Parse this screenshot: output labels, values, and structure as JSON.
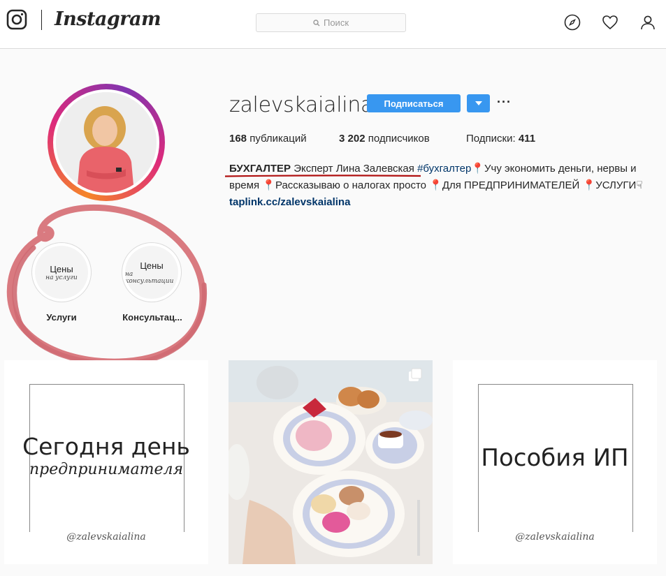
{
  "app": {
    "name": "Instagram"
  },
  "search": {
    "placeholder": "Поиск"
  },
  "profile": {
    "username": "zalevskaialina",
    "follow_label": "Подписаться",
    "more_label": "···",
    "stats": {
      "posts_count": "168",
      "posts_label": "публикаций",
      "followers_count": "3 202",
      "followers_label": "подписчиков",
      "following_label": "Подписки:",
      "following_count": "411"
    },
    "bio": {
      "title_bold": "БУХГАЛТЕР",
      "title_rest": "Эксперт Лина Залевская",
      "hashtag": "#бухгалтер",
      "part1": "Учу экономить деньги, нервы и время",
      "part2": "Рассказываю о налогах просто",
      "part3": "Для ПРЕДПРИНИМАТЕЛЕЙ",
      "part4": "УСЛУГИ",
      "link": "taplink.cc/zalevskaialina"
    }
  },
  "highlights": [
    {
      "label": "Услуги",
      "cover_title": "Цены",
      "cover_sub": "на услуги"
    },
    {
      "label": "Консультац...",
      "cover_title": "Цены",
      "cover_sub": "на консультации"
    }
  ],
  "posts": [
    {
      "title": "Сегодня день",
      "subtitle": "предпринимателя",
      "handle": "@zalevskaialina"
    },
    {
      "type": "photo",
      "multi": true
    },
    {
      "title": "Пособия ИП",
      "handle": "@zalevskaialina"
    }
  ],
  "colors": {
    "accent": "#3897f0",
    "link": "#003569",
    "scribble": "#d66b74",
    "underline": "#b01010"
  }
}
